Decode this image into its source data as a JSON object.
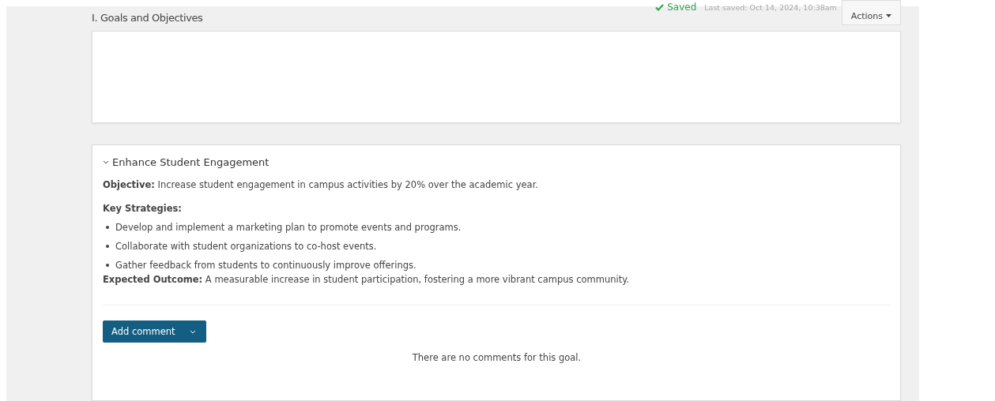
{
  "section": {
    "title": "I. Goals and Objectives"
  },
  "save_status": {
    "label": "Saved",
    "last_saved": "Last saved: Oct 14, 2024, 10:38am"
  },
  "actions_button": {
    "label": "Actions"
  },
  "goal": {
    "title": "Enhance Student Engagement",
    "expanded": true,
    "objective": "**Objective:** Increase student engagement in campus activities by 20% over the academic year.",
    "strategies_heading": "Key Strategies:",
    "strategies": [
      "Develop and implement a marketing plan to promote events and programs.",
      "Collaborate with student organizations to co-host events.",
      "Gather feedback from students to continuously improve offerings."
    ],
    "outcome": "**Expected Outcome:** A measurable increase in student participation, fostering a more vibrant campus community."
  },
  "comments": {
    "button": "Add comment",
    "empty_message": "There are no comments for this goal."
  }
}
